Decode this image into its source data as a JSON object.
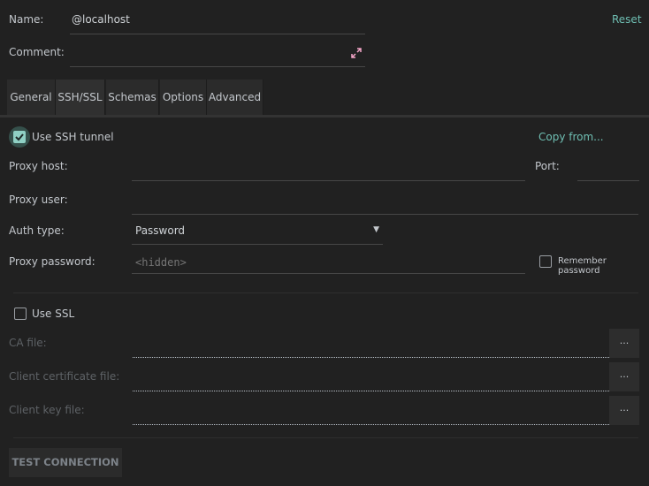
{
  "header": {
    "name_label": "Name:",
    "name_value": "@localhost",
    "comment_label": "Comment:",
    "comment_value": "",
    "reset_label": "Reset",
    "expand_icon": "expand-icon",
    "expand_color": "#f4a6c8"
  },
  "tabs": [
    {
      "label": "General"
    },
    {
      "label": "SSH/SSL",
      "active": true
    },
    {
      "label": "Schemas"
    },
    {
      "label": "Options"
    },
    {
      "label": "Advanced"
    }
  ],
  "ssh": {
    "use_ssh_label": "Use SSH tunnel",
    "use_ssh_checked": true,
    "copy_from_label": "Copy from...",
    "proxy_host_label": "Proxy host:",
    "proxy_host_value": "",
    "port_label": "Port:",
    "port_value": "",
    "proxy_user_label": "Proxy user:",
    "proxy_user_value": "",
    "auth_type_label": "Auth type:",
    "auth_type_value": "Password",
    "proxy_password_label": "Proxy password:",
    "proxy_password_placeholder": "<hidden>",
    "remember_password_label": "Remember password",
    "remember_password_checked": false
  },
  "ssl": {
    "use_ssl_label": "Use SSL",
    "use_ssl_checked": false,
    "ca_file_label": "CA file:",
    "client_cert_label": "Client certificate file:",
    "client_key_label": "Client key file:",
    "browse_label": "..."
  },
  "footer": {
    "test_connection_label": "TEST CONNECTION"
  },
  "colors": {
    "background": "#212121",
    "accent": "#6fbfb3",
    "checkbox_checked": "#5aa394"
  }
}
